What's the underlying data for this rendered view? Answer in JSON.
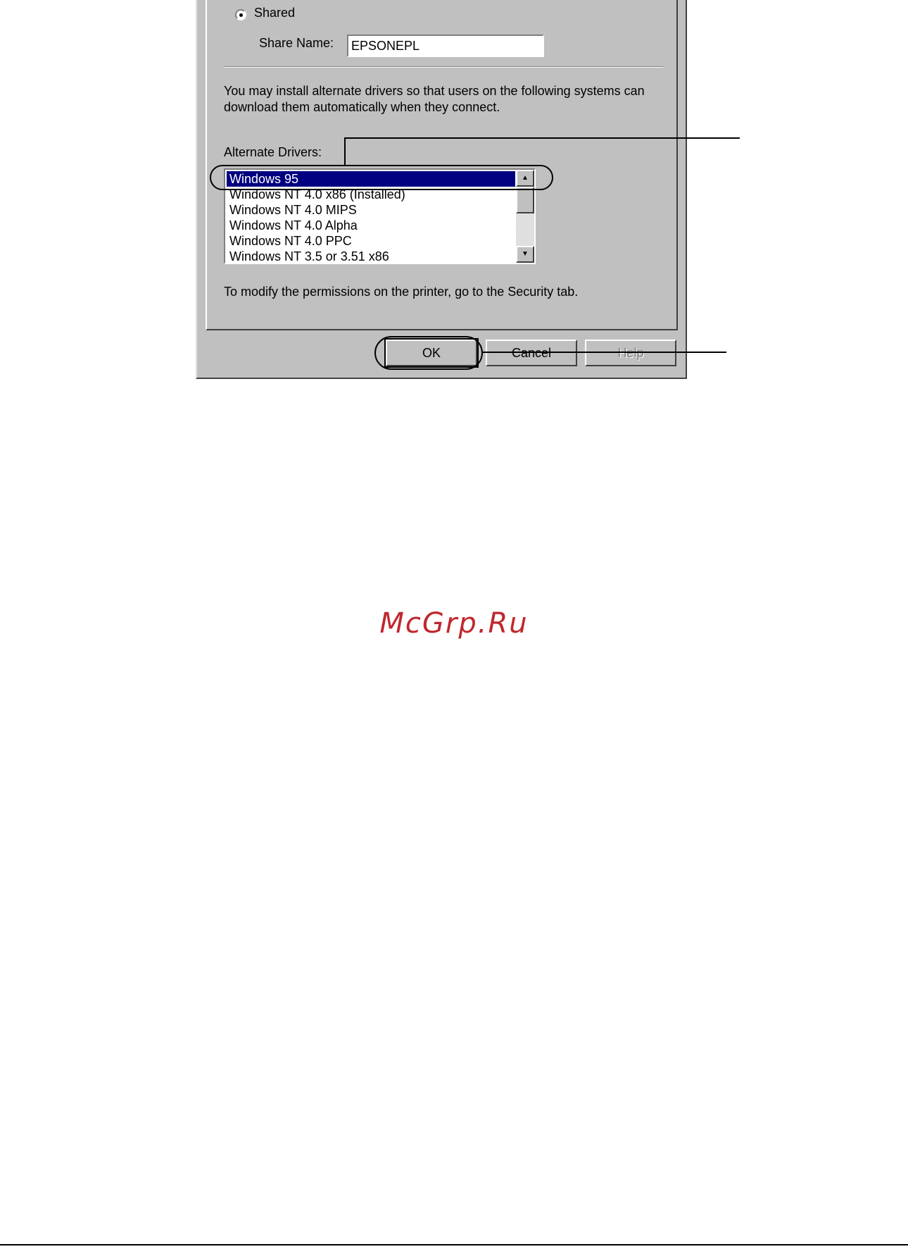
{
  "sharing": {
    "shared_label": "Shared",
    "share_name_label": "Share Name:",
    "share_name_value": "EPSONEPL",
    "info_text_line1": "You may install alternate drivers so that users on the following systems can",
    "info_text_line2": "download them automatically when they connect.",
    "alternate_drivers_label": "Alternate Drivers:",
    "alternate_drivers": [
      "Windows 95",
      "Windows NT 4.0 x86 (Installed)",
      "Windows NT 4.0 MIPS",
      "Windows NT 4.0 Alpha",
      "Windows NT 4.0 PPC",
      "Windows NT 3.5 or 3.51 x86"
    ],
    "selected_driver": "Windows 95",
    "security_note": "To modify the permissions on the printer, go to the Security tab."
  },
  "buttons": {
    "ok": "OK",
    "cancel": "Cancel",
    "help": "Help"
  },
  "icons": {
    "scroll_up": "scroll-up-arrow-icon",
    "scroll_down": "scroll-down-arrow-icon"
  },
  "watermark": "McGrp.Ru",
  "colors": {
    "dialog_bg": "#c0c0c0",
    "selection": "#000080",
    "watermark": "#c0272d"
  }
}
